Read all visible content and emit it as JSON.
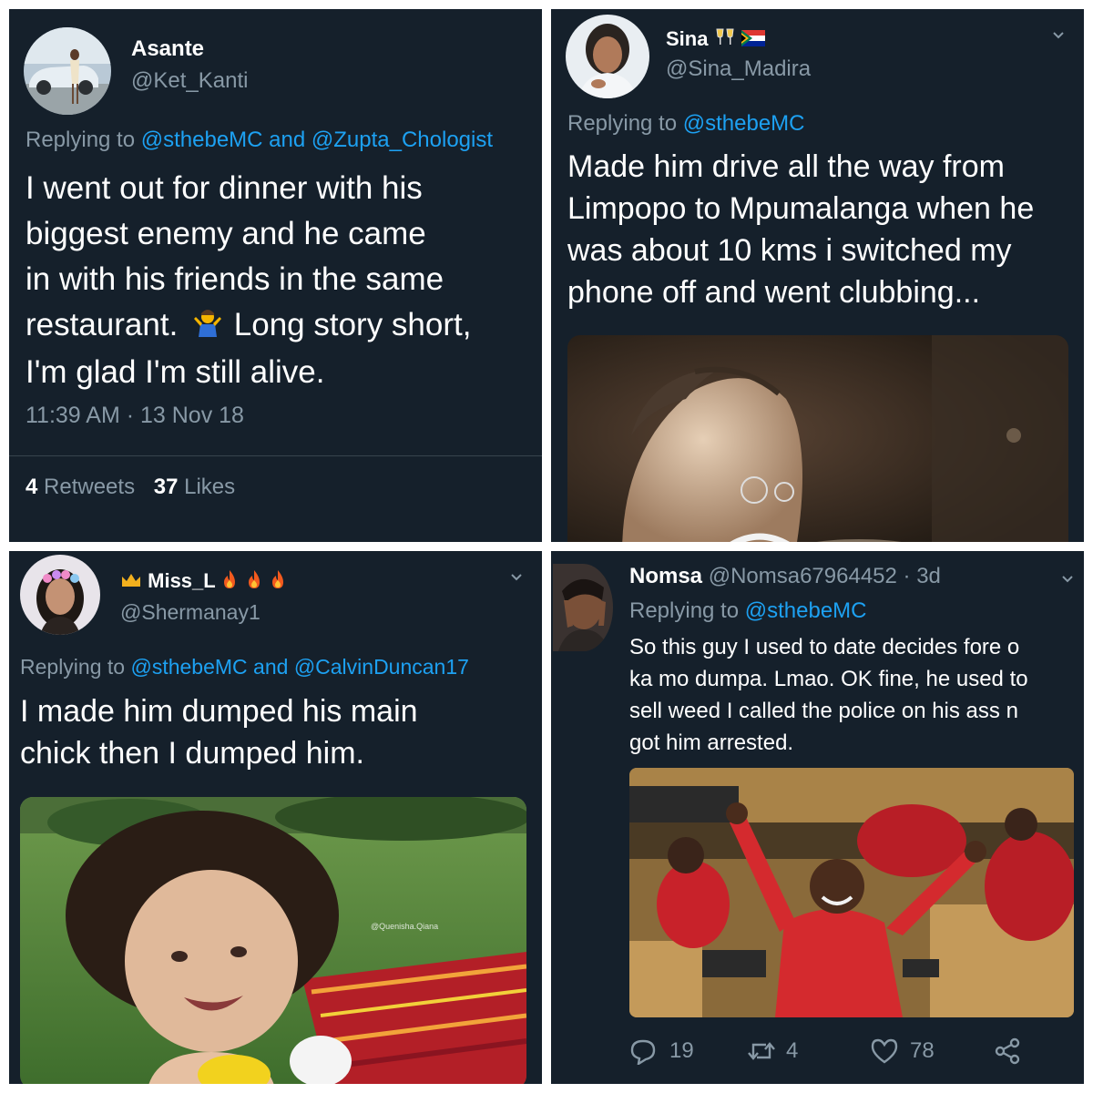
{
  "tweets": [
    {
      "display_name": "Asante",
      "handle": "@Ket_Kanti",
      "replying_prefix": "Replying to",
      "mention1": "@sthebeMC",
      "joiner": "and",
      "mention2": "@Zupta_Chologist",
      "lines": [
        "I went out for dinner with his",
        "biggest enemy and he came",
        "in with his friends in the same",
        "restaurant.",
        "Long story short,",
        "I'm glad I'm still alive."
      ],
      "timestamp": "11:39 AM · 13 Nov 18",
      "retweets_count": "4",
      "retweets_label": "Retweets",
      "likes_count": "37",
      "likes_label": "Likes"
    },
    {
      "display_name": "Sina",
      "handle": "@Sina_Madira",
      "replying_prefix": "Replying to",
      "mention1": "@sthebeMC",
      "lines": [
        "Made him drive all the way from",
        "Limpopo to Mpumalanga when he",
        "was about 10 kms i switched my",
        "phone off and went clubbing..."
      ],
      "media": "photo-old-man-with-glasses"
    },
    {
      "display_name": "Miss_L",
      "handle": "@Shermanay1",
      "replying_prefix": "Replying to",
      "mention1": "@sthebeMC",
      "joiner": "and",
      "mention2": "@CalvinDuncan17",
      "lines": [
        "I made him dumped his main",
        "chick then I dumped him."
      ],
      "media": "photo-curly-haired-toddler",
      "watermark": "@Quenisha.Qiana"
    },
    {
      "display_name": "Nomsa",
      "handle": "@Nomsa67964452",
      "age": "· 3d",
      "replying_prefix": "Replying to",
      "mention1": "@sthebeMC",
      "lines": [
        "So this guy I used to date decides fore o",
        "ka mo dumpa. Lmao. OK fine, he used to",
        "sell weed I called the police on his ass n",
        "got him arrested."
      ],
      "media": "photo-parliament-red-overalls",
      "reply_count": "19",
      "retweet_count": "4",
      "like_count": "78"
    }
  ],
  "colors": {
    "background": "#15202b",
    "text": "#ffffff",
    "muted": "#8899a6",
    "link": "#1da1f2"
  },
  "icons": [
    "chevron-down-icon",
    "reply-icon",
    "retweet-icon",
    "heart-icon",
    "share-icon",
    "shrug-emoji",
    "flame-emoji",
    "crown-emoji",
    "cheers-emoji",
    "sa-flag-emoji"
  ]
}
